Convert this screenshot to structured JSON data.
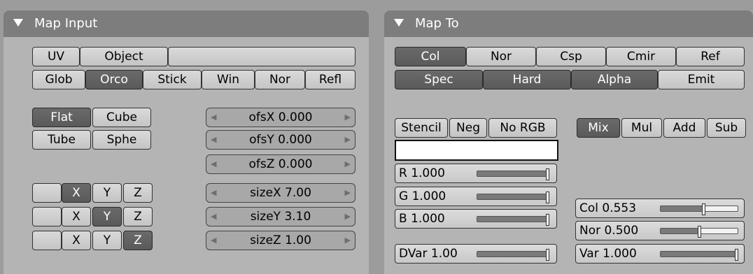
{
  "map_input": {
    "title": "Map Input",
    "row1": [
      "UV",
      "Object",
      ""
    ],
    "row2": [
      "Glob",
      "Orco",
      "Stick",
      "Win",
      "Nor",
      "Refl"
    ],
    "row2_active": 1,
    "proj": [
      "Flat",
      "Cube",
      "Tube",
      "Sphe"
    ],
    "proj_active": 0,
    "xyz_rows": [
      {
        "labels": [
          "",
          "X",
          "Y",
          "Z"
        ],
        "active": 1
      },
      {
        "labels": [
          "",
          "X",
          "Y",
          "Z"
        ],
        "active": 2
      },
      {
        "labels": [
          "",
          "X",
          "Y",
          "Z"
        ],
        "active": 3
      }
    ],
    "fields": [
      {
        "label": "ofsX 0.000"
      },
      {
        "label": "ofsY 0.000"
      },
      {
        "label": "ofsZ 0.000"
      },
      {
        "label": "sizeX 7.00"
      },
      {
        "label": "sizeY 3.10"
      },
      {
        "label": "sizeZ 1.00"
      }
    ]
  },
  "map_to": {
    "title": "Map To",
    "row1": [
      "Col",
      "Nor",
      "Csp",
      "Cmir",
      "Ref"
    ],
    "row1_active": [
      0
    ],
    "row2": [
      "Spec",
      "Hard",
      "Alpha",
      "Emit"
    ],
    "row2_active": [
      0,
      1,
      2
    ],
    "toggles": [
      "Stencil",
      "Neg",
      "No RGB"
    ],
    "blend": [
      "Mix",
      "Mul",
      "Add",
      "Sub"
    ],
    "blend_active": 0,
    "color_swatch": "#ffffff",
    "rgb": [
      {
        "label": "R 1.000",
        "value": 1.0
      },
      {
        "label": "G 1.000",
        "value": 1.0
      },
      {
        "label": "B 1.000",
        "value": 1.0
      }
    ],
    "dvar": {
      "label": "DVar 1.00",
      "value": 1.0
    },
    "sliders": [
      {
        "label": "Col 0.553",
        "value": 0.553
      },
      {
        "label": "Nor 0.500",
        "value": 0.5
      },
      {
        "label": "Var 1.000",
        "value": 1.0
      }
    ]
  }
}
